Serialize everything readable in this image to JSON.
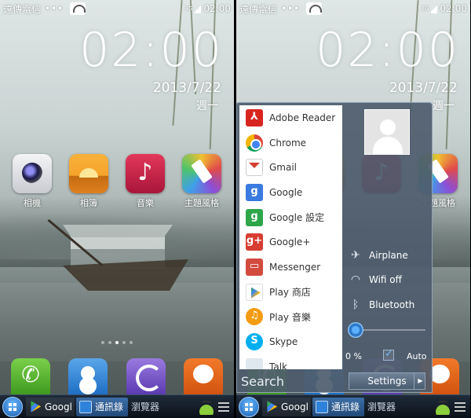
{
  "status": {
    "carrier": "遠傳電信",
    "dots": "•••",
    "network": "3G",
    "time": "02:00"
  },
  "clock": {
    "time": "02:00",
    "date": "2013/7/22",
    "weekday": "週一"
  },
  "home_apps": [
    {
      "label": "相機",
      "icon": "camera-icon"
    },
    {
      "label": "相簿",
      "icon": "gallery-icon"
    },
    {
      "label": "音樂",
      "icon": "music-icon"
    },
    {
      "label": "主題風格",
      "icon": "theme-icon"
    }
  ],
  "dock_apps": [
    "phone-icon",
    "contacts-icon",
    "browser-icon",
    "messages-icon"
  ],
  "taskbar": {
    "play_label": "Googl",
    "contacts_label": "通訊錄",
    "browser_label": "瀏覽器"
  },
  "start_menu": {
    "apps": [
      {
        "label": "Adobe Reader",
        "icon": "adobe-reader-icon"
      },
      {
        "label": "Chrome",
        "icon": "chrome-icon"
      },
      {
        "label": "Gmail",
        "icon": "gmail-icon"
      },
      {
        "label": "Google",
        "icon": "google-icon"
      },
      {
        "label": "Google 設定",
        "icon": "google-settings-icon"
      },
      {
        "label": "Google+",
        "icon": "google-plus-icon"
      },
      {
        "label": "Messenger",
        "icon": "messenger-icon"
      },
      {
        "label": "Play 商店",
        "icon": "play-store-icon"
      },
      {
        "label": "Play 音樂",
        "icon": "play-music-icon"
      },
      {
        "label": "Skype",
        "icon": "skype-icon"
      },
      {
        "label": "Talk",
        "icon": "talk-icon"
      }
    ],
    "search_label": "Search",
    "toggles": {
      "airplane": "Airplane",
      "wifi": "Wifi off",
      "bluetooth": "Bluetooth"
    },
    "brightness": {
      "value_text": "0 %",
      "value": 0,
      "auto_label": "Auto",
      "auto_checked": true
    },
    "settings_label": "Settings"
  }
}
